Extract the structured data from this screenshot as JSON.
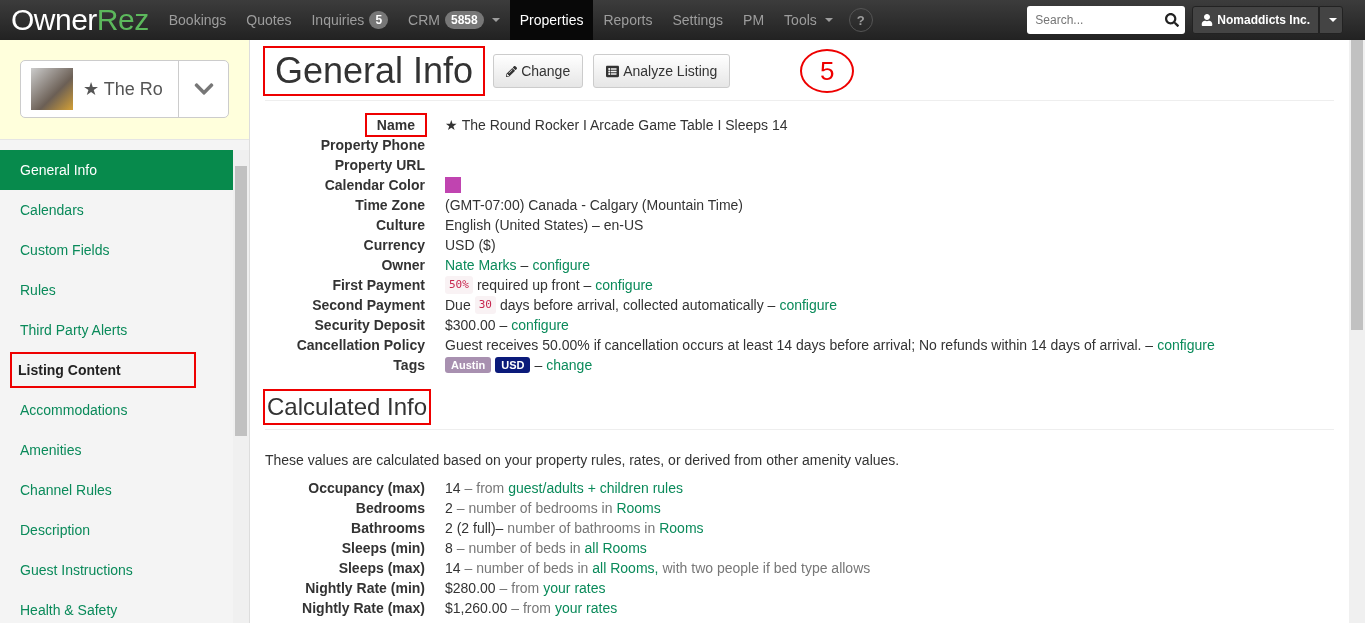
{
  "nav": {
    "brand": {
      "plain": "Owner",
      "bold": "Rez"
    },
    "items": [
      {
        "label": "Bookings",
        "selected": false
      },
      {
        "label": "Quotes",
        "selected": false
      },
      {
        "label": "Inquiries",
        "badge": "5",
        "selected": false
      },
      {
        "label": "CRM",
        "badge": "5858",
        "caret": true,
        "selected": false
      },
      {
        "label": "Properties",
        "selected": true
      },
      {
        "label": "Reports",
        "selected": false
      },
      {
        "label": "Settings",
        "selected": false
      },
      {
        "label": "PM",
        "selected": false
      },
      {
        "label": "Tools",
        "caret": true,
        "selected": false
      }
    ],
    "help": "?",
    "search": {
      "placeholder": "Search..."
    },
    "user": "Nomaddicts Inc."
  },
  "sidebar": {
    "property": "★ The Ro",
    "items": [
      {
        "label": "General Info",
        "selected": true,
        "boxed": false
      },
      {
        "label": "Calendars",
        "selected": false,
        "boxed": false
      },
      {
        "label": "Custom Fields",
        "selected": false,
        "boxed": false
      },
      {
        "label": "Rules",
        "selected": false,
        "boxed": false
      },
      {
        "label": "Third Party Alerts",
        "selected": false,
        "boxed": false
      },
      {
        "label": "Listing Content",
        "selected": false,
        "boxed": true
      },
      {
        "label": "Accommodations",
        "selected": false,
        "boxed": false
      },
      {
        "label": "Amenities",
        "selected": false,
        "boxed": false
      },
      {
        "label": "Channel Rules",
        "selected": false,
        "boxed": false
      },
      {
        "label": "Description",
        "selected": false,
        "boxed": false
      },
      {
        "label": "Guest Instructions",
        "selected": false,
        "boxed": false
      },
      {
        "label": "Health & Safety",
        "selected": false,
        "boxed": false
      }
    ]
  },
  "general": {
    "title": "General Info",
    "boxed": true,
    "buttons": [
      "Change",
      "Analyze Listing"
    ],
    "step": "5",
    "rows": [
      {
        "label": "Name",
        "boxed": true,
        "value": [
          {
            "kind": "text",
            "text": "★ The Round Rocker I Arcade Game Table I Sleeps 14"
          }
        ]
      },
      {
        "label": "Property Phone",
        "boxed": false,
        "value": []
      },
      {
        "label": "Property URL",
        "boxed": false,
        "value": []
      },
      {
        "label": "Calendar Color",
        "boxed": false,
        "value": [
          {
            "kind": "swatch",
            "color": "#c044b0"
          }
        ]
      },
      {
        "label": "Time Zone",
        "boxed": false,
        "value": [
          {
            "kind": "text",
            "text": "(GMT-07:00) Canada - Calgary (Mountain Time)"
          }
        ]
      },
      {
        "label": "Culture",
        "boxed": false,
        "value": [
          {
            "kind": "text",
            "text": "English (United States) – en-US"
          }
        ]
      },
      {
        "label": "Currency",
        "boxed": false,
        "value": [
          {
            "kind": "text",
            "text": "USD ($)"
          }
        ]
      },
      {
        "label": "Owner",
        "boxed": false,
        "value": [
          {
            "kind": "link",
            "text": "Nate Marks"
          },
          {
            "kind": "text",
            "text": "–"
          },
          {
            "kind": "link",
            "text": "configure"
          }
        ]
      },
      {
        "label": "First Payment",
        "boxed": false,
        "value": [
          {
            "kind": "code",
            "text": "50%"
          },
          {
            "kind": "text",
            "text": "required up front –"
          },
          {
            "kind": "link",
            "text": "configure"
          }
        ]
      },
      {
        "label": "Second Payment",
        "boxed": false,
        "value": [
          {
            "kind": "text",
            "text": "Due"
          },
          {
            "kind": "code",
            "text": "30"
          },
          {
            "kind": "text",
            "text": "days before arrival, collected automatically –"
          },
          {
            "kind": "link",
            "text": "configure"
          }
        ]
      },
      {
        "label": "Security Deposit",
        "boxed": false,
        "value": [
          {
            "kind": "text",
            "text": "$300.00 –"
          },
          {
            "kind": "link",
            "text": "configure"
          }
        ]
      },
      {
        "label": "Cancellation Policy",
        "boxed": false,
        "value": [
          {
            "kind": "text",
            "text": "Guest receives 50.00% if cancellation occurs at least 14 days before arrival; No refunds within 14 days of arrival. –"
          },
          {
            "kind": "link",
            "text": "configure"
          }
        ]
      },
      {
        "label": "Tags",
        "boxed": false,
        "value": [
          {
            "kind": "tag",
            "text": "Austin",
            "color": "#a890b0"
          },
          {
            "kind": "tag",
            "text": "USD",
            "color": "#0a1a7a"
          },
          {
            "kind": "text",
            "text": "–"
          },
          {
            "kind": "link",
            "text": "change"
          }
        ]
      }
    ]
  },
  "calculated": {
    "title": "Calculated Info",
    "boxed": true,
    "intro": "These values are calculated based on your property rules, rates, or derived from other amenity values.",
    "rows": [
      {
        "label": "Occupancy (max)",
        "value": [
          {
            "kind": "text",
            "text": "14"
          },
          {
            "kind": "muted",
            "text": "– from"
          },
          {
            "kind": "link",
            "text": "guest/adults + children rules"
          }
        ]
      },
      {
        "label": "Bedrooms",
        "value": [
          {
            "kind": "text",
            "text": "2"
          },
          {
            "kind": "muted",
            "text": "– number of bedrooms in"
          },
          {
            "kind": "link",
            "text": "Rooms"
          }
        ]
      },
      {
        "label": "Bathrooms",
        "value": [
          {
            "kind": "text",
            "text": "2 (2 full)–"
          },
          {
            "kind": "muted",
            "text": "number of bathrooms in"
          },
          {
            "kind": "link",
            "text": "Rooms"
          }
        ]
      },
      {
        "label": "Sleeps (min)",
        "value": [
          {
            "kind": "text",
            "text": "8"
          },
          {
            "kind": "muted",
            "text": "– number of beds in"
          },
          {
            "kind": "link",
            "text": "all Rooms"
          }
        ]
      },
      {
        "label": "Sleeps (max)",
        "value": [
          {
            "kind": "text",
            "text": "14"
          },
          {
            "kind": "muted",
            "text": "– number of beds in"
          },
          {
            "kind": "link",
            "text": "all Rooms,"
          },
          {
            "kind": "muted",
            "text": "with two people if bed type allows"
          }
        ]
      },
      {
        "label": "Nightly Rate (min)",
        "value": [
          {
            "kind": "text",
            "text": "$280.00"
          },
          {
            "kind": "muted",
            "text": "– from"
          },
          {
            "kind": "link",
            "text": "your rates"
          }
        ]
      },
      {
        "label": "Nightly Rate (max)",
        "value": [
          {
            "kind": "text",
            "text": "$1,260.00"
          },
          {
            "kind": "muted",
            "text": "– from"
          },
          {
            "kind": "link",
            "text": "your rates"
          }
        ]
      }
    ]
  }
}
